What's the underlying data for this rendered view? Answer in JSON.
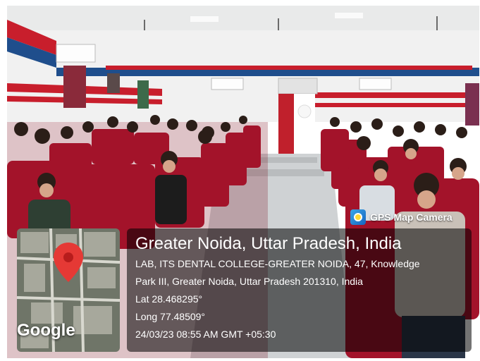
{
  "scene": {
    "description_colors": {
      "wall": "#f2f2f2",
      "stripe_red": "#c81e2c",
      "stripe_blue": "#1f4e8c",
      "seat_red": "#a3132a",
      "floor": "#cfd2d4"
    }
  },
  "gps_badge": {
    "icon": "gps-camera-icon",
    "label": "GPS Map Camera"
  },
  "location": {
    "title": "Greater Noida, Uttar Pradesh, India",
    "address_line1": "LAB, ITS DENTAL COLLEGE-GREATER NOIDA, 47, Knowledge",
    "address_line2": "Park III, Greater Noida, Uttar Pradesh 201310, India",
    "lat": "Lat 28.468295°",
    "long": "Long 77.48509°",
    "datetime": "24/03/23 08:55 AM GMT +05:30"
  },
  "map": {
    "icon": "map-pin-icon",
    "logo": "Google",
    "pin_color": "#e53935"
  }
}
